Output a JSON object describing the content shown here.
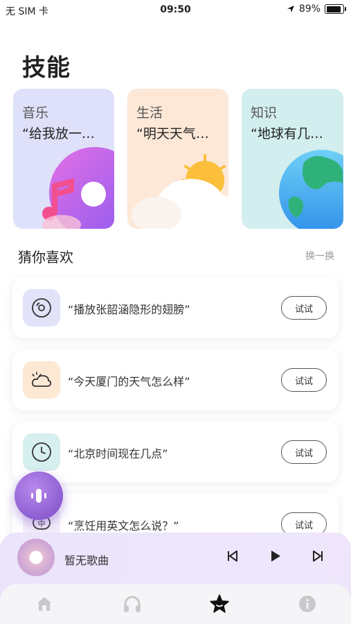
{
  "status_bar": {
    "carrier": "无 SIM 卡",
    "time": "09:50",
    "battery_text": "89%",
    "battery_level": 0.89
  },
  "page_title": "技能",
  "skill_cards": [
    {
      "category": "音乐",
      "example": "“给我放一…",
      "color": "#dfe0f9"
    },
    {
      "category": "生活",
      "example": "“明天天气…",
      "color": "#fde7d6"
    },
    {
      "category": "知识",
      "example": "“地球有几…",
      "color": "#d3eeee"
    }
  ],
  "recommend": {
    "title": "猜你喜欢",
    "refresh_label": "换一换",
    "items": [
      {
        "text": "“播放张韶涵隐形的翅膀”",
        "button": "试试",
        "icon": "music-disc-icon"
      },
      {
        "text": "“今天厦门的天气怎么样”",
        "button": "试试",
        "icon": "weather-cloud-icon"
      },
      {
        "text": "“北京时间现在几点”",
        "button": "试试",
        "icon": "clock-icon"
      },
      {
        "text": "“烹饪用英文怎么说？”",
        "button": "试试",
        "icon": "translate-icon"
      }
    ]
  },
  "player": {
    "song_title": "暂无歌曲"
  },
  "tabs": [
    {
      "icon": "home-icon",
      "active": false
    },
    {
      "icon": "headphones-icon",
      "active": false
    },
    {
      "icon": "star-icon",
      "active": true
    },
    {
      "icon": "info-icon",
      "active": false
    }
  ],
  "colors": {
    "accent": "#7b4cc6",
    "player_bg": "#ebe4fb"
  }
}
